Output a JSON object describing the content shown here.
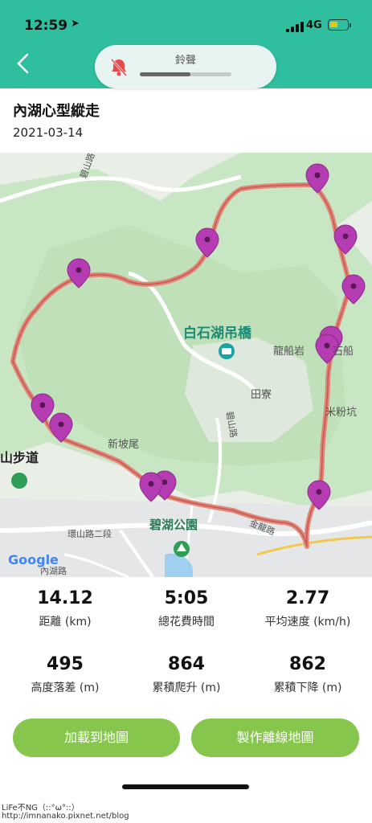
{
  "status_bar": {
    "time": "12:59",
    "network": "4G"
  },
  "hud": {
    "label": "鈴聲",
    "level": 0.55,
    "icon": "bell-muted-icon"
  },
  "header": {
    "back_icon": "chevron-left-icon",
    "title": "內湖心型縱走",
    "date": "2021-03-14"
  },
  "map": {
    "labels": {
      "bridge": "白石湖吊橋",
      "village": "田寮",
      "xinpowei": "新坡尾",
      "bihu": "碧湖公園",
      "trail": "山步道",
      "longchuan": "龍船岩",
      "baishi": "石船",
      "mifen": "米粉坑",
      "road1": "環山路二段",
      "road2": "金龍路",
      "road3": "碧山路",
      "road4": "內湖路",
      "road5": "碧山路"
    },
    "google": "Google",
    "pins": 12
  },
  "stats": [
    {
      "value": "14.12",
      "label": "距離 (km)"
    },
    {
      "value": "5:05",
      "label": "總花費時間"
    },
    {
      "value": "2.77",
      "label": "平均速度 (km/h)"
    },
    {
      "value": "495",
      "label": "高度落差 (m)"
    },
    {
      "value": "864",
      "label": "累積爬升 (m)"
    },
    {
      "value": "862",
      "label": "累積下降 (m)"
    }
  ],
  "buttons": {
    "load_map": "加載到地圖",
    "make_offline": "製作離線地圖"
  },
  "credit": {
    "line1": "LiFe不NG（::°ω°::）",
    "line2": "http://imnanako.pixnet.net/blog"
  },
  "colors": {
    "header": "#2fbf9f",
    "button": "#86c64d",
    "pin": "#b63cb4",
    "route": "#e0867a"
  }
}
